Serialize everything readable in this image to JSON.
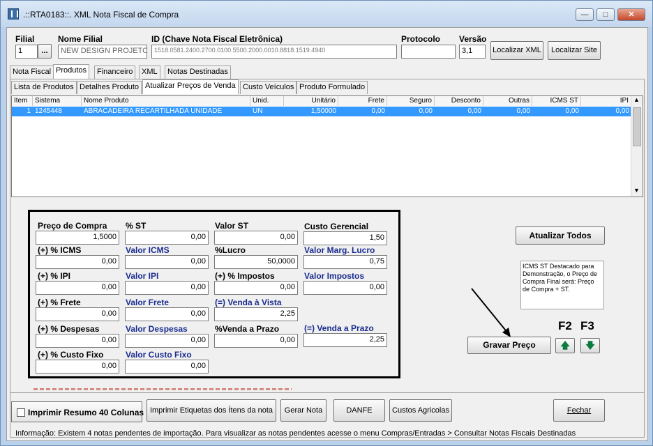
{
  "window": {
    "title": ".::RTA0183::. XML Nota Fiscal de Compra"
  },
  "header": {
    "filial_label": "Filial",
    "filial_value": "1",
    "filial_lookup": "...",
    "nome_filial_label": "Nome Filial",
    "nome_filial_value": "NEW DESIGN PROJETO SI",
    "chave_label": "ID (Chave Nota Fiscal Eletrônica)",
    "chave_value": "1518.0581.2400.2700.0100.5500.2000.0010.8818.1519.4940",
    "protocolo_label": "Protocolo",
    "protocolo_value": "",
    "versao_label": "Versão",
    "versao_value": "3,1",
    "localizar_xml": "Localizar XML",
    "localizar_site": "Localizar Site"
  },
  "main_tabs": [
    "Nota Fiscal",
    "Produtos",
    "Financeiro",
    "XML",
    "Notas Destinadas"
  ],
  "sub_tabs": [
    "Lista de Produtos",
    "Detalhes Produto",
    "Atualizar Preços de Venda",
    "Custo Veículos",
    "Produto Formulado"
  ],
  "grid": {
    "headers": [
      "Item",
      "Sistema",
      "Nome Produto",
      "Unid.",
      "Unitário",
      "Frete",
      "Seguro",
      "Desconto",
      "Outras",
      "ICMS ST",
      "IPI"
    ],
    "row": [
      "1",
      "1245448",
      "ABRACADEIRA RECARTILHADA UNIDADE",
      "UN",
      "1,50000",
      "0,00",
      "0,00",
      "0,00",
      "0,00",
      "0,00",
      "0,00"
    ]
  },
  "calc": {
    "preco_compra_label": "Preço de Compra",
    "preco_compra": "1,5000",
    "pct_st_label": "% ST",
    "pct_st": "0,00",
    "valor_st_label": "Valor ST",
    "valor_st": "0,00",
    "custo_gerencial_label": "Custo Gerencial",
    "custo_gerencial": "1,50",
    "pct_icms_label": "(+) % ICMS",
    "pct_icms": "0,00",
    "valor_icms_label": "Valor ICMS",
    "valor_icms": "0,00",
    "pct_lucro_label": "%Lucro",
    "pct_lucro": "50,0000",
    "valor_marg_lucro_label": "Valor Marg. Lucro",
    "valor_marg_lucro": "0,75",
    "pct_ipi_label": "(+) % IPI",
    "pct_ipi": "0,00",
    "valor_ipi_label": "Valor IPI",
    "valor_ipi": "0,00",
    "pct_impostos_label": "(+) % Impostos",
    "pct_impostos": "0,00",
    "valor_impostos_label": "Valor Impostos",
    "valor_impostos": "0,00",
    "pct_frete_label": "(+) % Frete",
    "pct_frete": "0,00",
    "valor_frete_label": "Valor Frete",
    "valor_frete": "0,00",
    "venda_vista_label": "(=) Venda à Vista",
    "venda_vista": "2,25",
    "pct_despesas_label": "(+) % Despesas",
    "pct_despesas": "0,00",
    "valor_despesas_label": "Valor Despesas",
    "valor_despesas": "0,00",
    "pct_venda_prazo_label": "%Venda a Prazo",
    "pct_venda_prazo": "0,00",
    "venda_prazo_label": "(=) Venda a Prazo",
    "venda_prazo": "2,25",
    "pct_custo_fixo_label": "(+) % Custo Fixo",
    "pct_custo_fixo": "0,00",
    "valor_custo_fixo_label": "Valor Custo Fixo",
    "valor_custo_fixo": "0,00"
  },
  "actions": {
    "atualizar_todos": "Atualizar Todos",
    "info_text": "ICMS ST Destacado para Demonstração, o Preço de Compra Final será: Preço de Compra + ST.",
    "gravar_preco": "Gravar Preço",
    "f2": "F2",
    "f3": "F3"
  },
  "footer": {
    "imprimir_resumo": "Imprimir Resumo 40 Colunas",
    "imprimir_etiquetas": "Imprimir Etiquetas dos Ítens da nota",
    "gerar_nota": "Gerar Nota",
    "danfe": "DANFE",
    "custos_agricolas": "Custos Agricolas",
    "fechar": "Fechar",
    "status": "Informação: Existem 4 notas pendentes de importação. Para visualizar as notas pendentes acesse o menu Compras/Entradas > Consultar Notas Fiscais Destinadas"
  }
}
